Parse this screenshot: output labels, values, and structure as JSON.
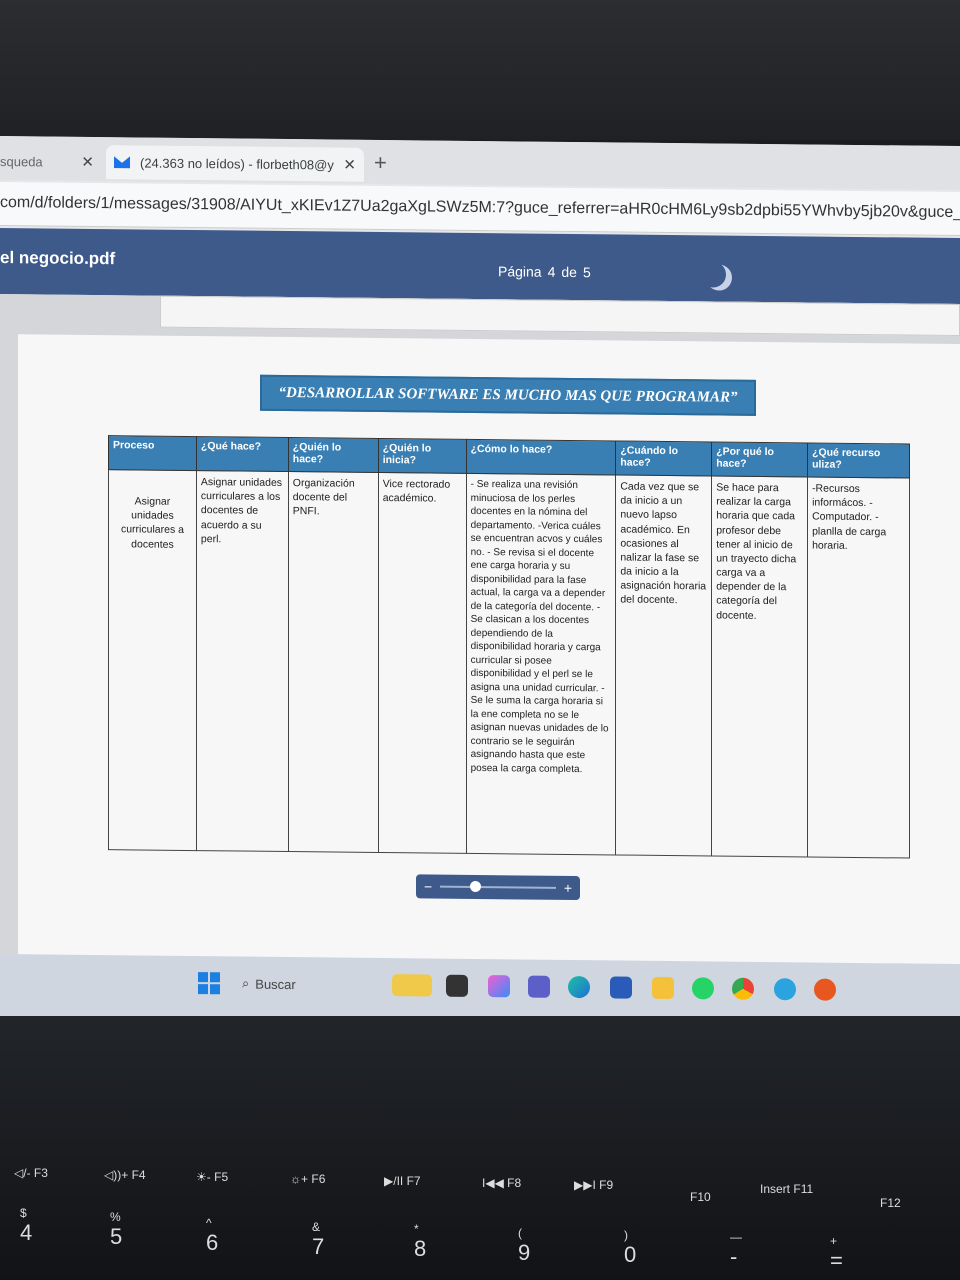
{
  "browser": {
    "tab1_title": "squeda",
    "tab2_title": "(24.363 no leídos) - florbeth08@y",
    "close_glyph": "✕",
    "new_tab_glyph": "+",
    "url": "com/d/folders/1/messages/31908/AIYUt_xKIEv1Z7Ua2gaXgLSWz5M:7?guce_referrer=aHR0cHM6Ly9sb2dpbi55YWhvby5jb20v&guce_referrer_si"
  },
  "pdf": {
    "filename": "el negocio.pdf",
    "page_label": "Página",
    "page_current": "4",
    "page_of": "de",
    "page_total": "5",
    "banner": "“DESARROLLAR SOFTWARE ES MUCHO MAS QUE PROGRAMAR”",
    "table": {
      "headers": [
        "Proceso",
        "¿Qué hace?",
        "¿Quién lo hace?",
        "¿Quién lo inicia?",
        "¿Cómo lo hace?",
        "¿Cuándo lo hace?",
        "¿Por qué lo hace?",
        "¿Qué recurso uliza?"
      ],
      "row": [
        "Asignar unidades curriculares a docentes",
        "Asignar unidades curriculares a los docentes de acuerdo a su perl.",
        "Organización docente del PNFI.",
        "Vice rectorado académico.",
        "- Se realiza una revisión minuciosa de los perles docentes en la nómina del departamento. -Verica cuáles se encuentran acvos y cuáles no. - Se revisa si el docente ene carga horaria y su disponibilidad para la fase actual, la carga va a depender de la categoría del docente. - Se clasican a los docentes dependiendo de la disponibilidad horaria y carga curricular si posee disponibilidad y el perl se le asigna una unidad curricular. -Se le suma la carga horaria si la ene completa no se le asignan nuevas unidades de lo contrario se le seguirán asignando hasta que este posea la carga completa.",
        "Cada vez que se da inicio a un nuevo lapso académico. En ocasiones al nalizar la fase se da inicio a la asignación horaria del docente.",
        "Se hace para realizar la carga horaria que cada profesor debe tener al inicio de un trayecto dicha carga va a depender de la categoría del docente.",
        "-Recursos informácos. -Computador. -planlla de carga horaria."
      ]
    },
    "zoom": {
      "minus": "−",
      "plus": "+"
    }
  },
  "taskbar": {
    "search_placeholder": "Buscar",
    "search_icon": "search-icon",
    "apps": [
      "widgets-icon",
      "file-explorer-icon",
      "copilot-icon",
      "teams-icon",
      "edge-icon",
      "store-icon",
      "folder-icon",
      "whatsapp-icon",
      "chrome-icon",
      "telegram-icon",
      "office-icon"
    ]
  },
  "keyboard": {
    "fkeys": [
      "F3",
      "F4",
      "F5",
      "F6",
      "F7",
      "F8",
      "F9",
      "F10",
      "F11",
      "F12"
    ],
    "fkey_symbols": [
      "◁/-",
      "◁))+",
      "☀-",
      "☼+",
      "▶/II",
      "I◀◀",
      "▶▶I",
      "",
      "Insert",
      ""
    ],
    "number_row": [
      {
        "top": "$",
        "bottom": "4"
      },
      {
        "top": "%",
        "bottom": "5"
      },
      {
        "top": "^",
        "bottom": "6"
      },
      {
        "top": "&",
        "bottom": "7"
      },
      {
        "top": "*",
        "bottom": "8"
      },
      {
        "top": "(",
        "bottom": "9"
      },
      {
        "top": ")",
        "bottom": "0"
      },
      {
        "top": "—",
        "bottom": "-"
      },
      {
        "top": "+",
        "bottom": "="
      }
    ]
  }
}
